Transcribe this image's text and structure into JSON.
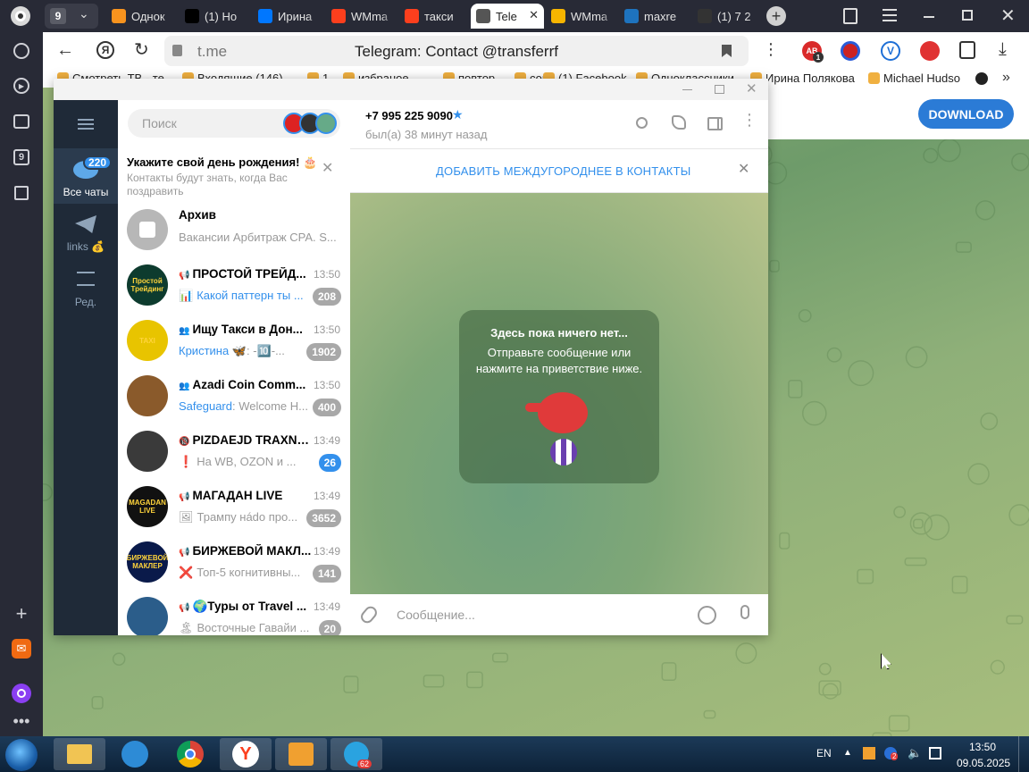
{
  "browser": {
    "tab_counter": "9",
    "tabs": [
      {
        "label": "Однок",
        "icon": "odnoklassniki-icon",
        "color": "#f7931e"
      },
      {
        "label": "(1) Ho",
        "icon": "x-icon",
        "color": "#000000"
      },
      {
        "label": "Ирина",
        "icon": "vk-icon",
        "color": "#0077ff"
      },
      {
        "label": "WMma",
        "icon": "yandex-icon",
        "color": "#fc3f1d"
      },
      {
        "label": "такси",
        "icon": "yandex-icon",
        "color": "#fc3f1d"
      },
      {
        "label": "Tele",
        "icon": "document-icon",
        "color": "#555555"
      },
      {
        "label": "WMma",
        "icon": "mail-at-icon",
        "color": "#f7b500"
      },
      {
        "label": "maxre",
        "icon": "ibb-icon",
        "color": "#1e73be"
      },
      {
        "label": "(1) 7 2",
        "icon": "circle-icon",
        "color": "#333333"
      }
    ],
    "address": {
      "domain": "t.me",
      "title": "Telegram: Contact @transferrf"
    },
    "extension_badge": "1",
    "bookmarks": [
      {
        "label": "Смотреть ТВ - те",
        "icon": "tv-icon"
      },
      {
        "label": "Входящие (146)",
        "icon": "gmail-icon"
      },
      {
        "label": "1",
        "icon": "folder-icon"
      },
      {
        "label": "избраное",
        "icon": "folder-icon"
      },
      {
        "label": "повтор",
        "icon": "folder-icon"
      },
      {
        "label": "соц",
        "icon": "folder-icon"
      },
      {
        "label": "(1) Facebook",
        "icon": "facebook-icon"
      },
      {
        "label": "Одноклассники",
        "icon": "odnoklassniki-icon"
      },
      {
        "label": "Ирина Полякова",
        "icon": "vk-icon"
      },
      {
        "label": "Michael Hudso",
        "icon": "x-icon"
      }
    ],
    "sidebar_badge": "9"
  },
  "tg_page": {
    "download_label": "DOWNLOAD"
  },
  "telegram": {
    "search_placeholder": "Поиск",
    "nav": {
      "all_chats_label": "Все чаты",
      "all_chats_badge": "220",
      "links_label": "links 💰",
      "edit_label": "Ред."
    },
    "birthday": {
      "title": "Укажите свой день рождения! 🎂",
      "subtitle": "Контакты будут знать, когда Вас поздравить"
    },
    "archive": {
      "title": "Архив",
      "preview": "Вакансии Арбитраж CPA. S..."
    },
    "chats": [
      {
        "title": "ПРОСТОЙ ТРЕЙД...",
        "type": "📢",
        "time": "13:50",
        "sender": "",
        "preview_icon": "📊",
        "preview": "Какой паттерн ты ...",
        "preview_blue": true,
        "badge": "208",
        "badge_blue": false,
        "avatar_color": "#0d3b2e",
        "avatar_text": "Простой Трейдинг"
      },
      {
        "title": "Ищу Такси в Дон...",
        "type": "👥",
        "time": "13:50",
        "sender": "Кристина 🦋",
        "preview_icon": "",
        "preview": ": -🔟-...",
        "preview_blue": false,
        "badge": "1902",
        "badge_blue": false,
        "avatar_color": "#e8c400",
        "avatar_text": "TAXI"
      },
      {
        "title": "Azadi Coin Comm...",
        "type": "👥",
        "time": "13:50",
        "sender": "Safeguard",
        "preview_icon": "",
        "preview": ": Welcome H...",
        "preview_blue": false,
        "badge": "400",
        "badge_blue": false,
        "avatar_color": "#8a5a2b",
        "avatar_text": ""
      },
      {
        "title": "PIZDAEJD TRAXNY...",
        "type": "🔞",
        "time": "13:49",
        "sender": "",
        "preview_icon": "❗",
        "preview": "На WB, OZON и ...",
        "preview_blue": false,
        "badge": "26",
        "badge_blue": true,
        "avatar_color": "#3a3a3a",
        "avatar_text": ""
      },
      {
        "title": "МАГАДАН LIVE",
        "type": "📢",
        "time": "13:49",
        "sender": "",
        "preview_icon": "🖼",
        "preview": "Трампу нádо про...",
        "preview_blue": false,
        "badge": "3652",
        "badge_blue": false,
        "avatar_color": "#111111",
        "avatar_text": "MAGADAN LIVE"
      },
      {
        "title": "БИРЖЕВОЙ МАКЛ...",
        "type": "📢",
        "time": "13:49",
        "sender": "",
        "preview_icon": "❌",
        "preview": "Топ-5 когнитивны...",
        "preview_blue": false,
        "badge": "141",
        "badge_blue": false,
        "avatar_color": "#0a1a4a",
        "avatar_text": "БИРЖЕВОЙ МАКЛЕР"
      },
      {
        "title": "🌍Туры от Travel ...",
        "type": "📢",
        "time": "13:49",
        "sender": "",
        "preview_icon": "🏝",
        "preview": "Восточные Гавайи ...",
        "preview_blue": false,
        "badge": "20",
        "badge_blue": false,
        "avatar_color": "#2b5d8a",
        "avatar_text": ""
      }
    ],
    "contact": {
      "phone": "+7 995 225 9090",
      "status": "был(а) 38 минут назад"
    },
    "add_contact_label": "ДОБАВИТЬ МЕЖДУГОРОДНЕЕ В КОНТАКТЫ",
    "empty": {
      "title": "Здесь пока ничего нет...",
      "line1": "Отправьте сообщение или",
      "line2": "нажмите на приветствие ниже."
    },
    "composer_placeholder": "Сообщение...",
    "taskbar_tg_badge": "62"
  },
  "taskbar": {
    "lang": "EN",
    "time": "13:50",
    "date": "09.05.2025",
    "tray_badge": "2"
  }
}
